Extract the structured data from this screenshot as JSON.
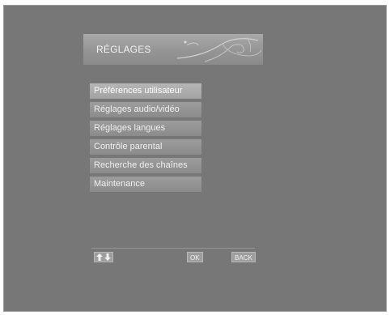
{
  "header": {
    "title": "RÉGLAGES"
  },
  "menu": {
    "items": [
      {
        "label": "Préférences utilisateur",
        "selected": true
      },
      {
        "label": "Réglages audio/vidéo",
        "selected": false
      },
      {
        "label": "Réglages langues",
        "selected": false
      },
      {
        "label": "Contrôle parental",
        "selected": false
      },
      {
        "label": "Recherche des chaînes",
        "selected": false
      },
      {
        "label": "Maintenance",
        "selected": false
      }
    ]
  },
  "footer": {
    "nav_icon": "up-down-arrows-icon",
    "ok_label": "OK",
    "back_label": "BACK"
  },
  "colors": {
    "screen_background": "#777777",
    "menu_item": "#939393",
    "menu_item_selected": "#ababab",
    "text": "#efefef"
  }
}
